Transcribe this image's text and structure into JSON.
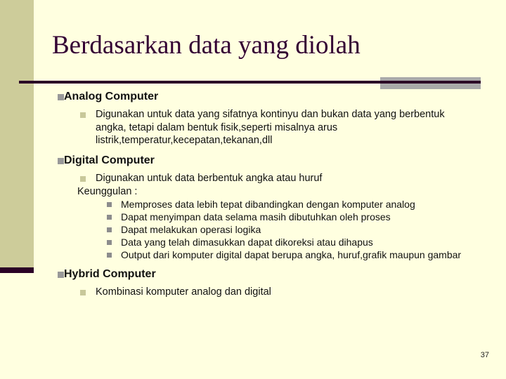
{
  "slide": {
    "title": "Berdasarkan data yang diolah",
    "page_number": "37",
    "colors": {
      "background": "#ffffe0",
      "side_band": "#cdcc9a",
      "accent_dark": "#2b0126",
      "title_text": "#330033",
      "rule_tab": "#a9a9a9",
      "bullet_level1": "#999999",
      "bullet_level2": "#c8c89a",
      "bullet_level3": "#8c8c8c",
      "body_text": "#111111"
    }
  },
  "outline": {
    "sections": [
      {
        "heading": "Analog Computer",
        "sub": "Digunakan untuk data yang sifatnya kontinyu dan bukan data yang berbentuk angka, tetapi dalam bentuk fisik,seperti misalnya arus listrik,temperatur,kecepatan,tekanan,dll"
      },
      {
        "heading": "Digital Computer",
        "sub": "Digunakan untuk data berbentuk angka atau huruf",
        "plain": "Keunggulan :",
        "items": [
          "Memproses data lebih tepat dibandingkan dengan komputer analog",
          "Dapat menyimpan data selama masih dibutuhkan oleh proses",
          "Dapat melakukan operasi logika",
          "Data yang telah dimasukkan dapat dikoreksi atau dihapus",
          "Output dari komputer digital dapat berupa angka, huruf,grafik maupun gambar"
        ]
      },
      {
        "heading": "Hybrid Computer",
        "sub": "Kombinasi komputer analog dan digital"
      }
    ]
  }
}
